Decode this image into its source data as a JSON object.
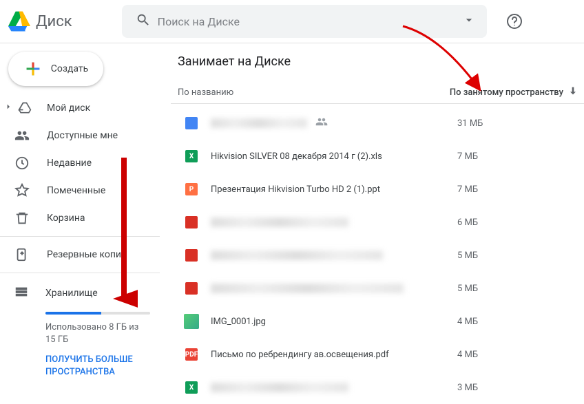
{
  "brand": "Диск",
  "search": {
    "placeholder": "Поиск на Диске"
  },
  "create_label": "Создать",
  "nav": {
    "mydrive": "Мой диск",
    "shared": "Доступные мне",
    "recent": "Недавние",
    "starred": "Помеченные",
    "trash": "Корзина",
    "backups": "Резервные копии",
    "storage": "Хранилище"
  },
  "storage": {
    "used_text": "Использовано 8 ГБ из 15 ГБ",
    "buy_more": "ПОЛУЧИТЬ БОЛЬШЕ ПРОСТРАНСТВА"
  },
  "main": {
    "title": "Занимает на Диске",
    "col_name": "По названию",
    "col_size": "По занятому пространству"
  },
  "files": [
    {
      "type": "blue",
      "name_hidden": true,
      "name": "",
      "size": "31 МБ",
      "shared": true
    },
    {
      "type": "xls",
      "name_hidden": false,
      "name": "Hikvision SILVER 08 декабря 2014 г (2).xls",
      "size": "7 МБ"
    },
    {
      "type": "ppt",
      "name_hidden": false,
      "name": "Презентация Hikvision Turbo HD 2 (1).ppt",
      "size": "7 МБ"
    },
    {
      "type": "vid",
      "name_hidden": true,
      "name": "",
      "size": "6 МБ"
    },
    {
      "type": "vid",
      "name_hidden": true,
      "name": "",
      "size": "5 МБ"
    },
    {
      "type": "vid",
      "name_hidden": true,
      "name": "",
      "size": "5 МБ"
    },
    {
      "type": "thumb",
      "name_hidden": false,
      "name": "IMG_0001.jpg",
      "size": "4 МБ"
    },
    {
      "type": "pdf",
      "name_hidden": false,
      "name": "Письмо по ребрендингу ав.освещения.pdf",
      "size": "4 МБ"
    },
    {
      "type": "xls",
      "name_hidden": true,
      "name": "",
      "size": "3 МБ"
    }
  ],
  "file_type_labels": {
    "xls": "X",
    "ppt": "P",
    "pdf": "PDF",
    "vid": "",
    "blue": "",
    "thumb": ""
  }
}
